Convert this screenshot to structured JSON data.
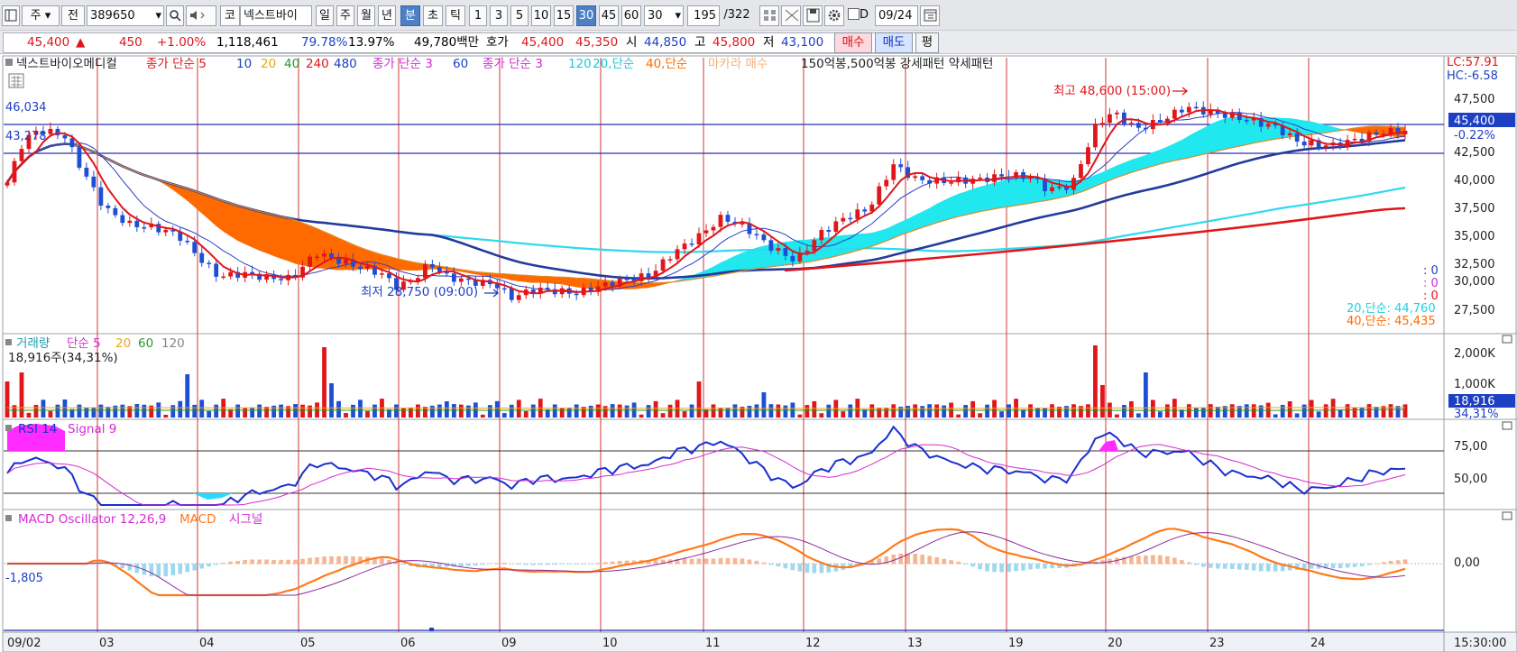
{
  "toolbar": {
    "market": "주",
    "prev_button": "전",
    "stock_code": "389650",
    "code_prefix": "코",
    "stock_name": "넥스트바이",
    "periods": [
      "일",
      "주",
      "월",
      "년",
      "분",
      "초",
      "틱"
    ],
    "selected_period": "분",
    "intervals": [
      "1",
      "3",
      "5",
      "10",
      "15",
      "30",
      "45",
      "60"
    ],
    "selected_interval": "30",
    "interval_input": "30",
    "bar_count": "195",
    "bar_total": "/322",
    "checkbox_label": "D",
    "date": "09/24"
  },
  "quote": {
    "price": "45,400",
    "change_arrow": "▲",
    "change": "450",
    "change_pct": "+1.00%",
    "volume": "1,118,461",
    "ratio1": "79.78%",
    "ratio2": "13.97%",
    "amount": "49,780백만",
    "hoga_label": "호가",
    "ask": "45,400",
    "bid": "45,350",
    "open_label": "시",
    "open": "44,850",
    "high_label": "고",
    "high": "45,800",
    "low_label": "저",
    "low": "43,100",
    "buy_label": "매수",
    "sell_label": "매도",
    "avg_label": "평"
  },
  "price_panel": {
    "legend": {
      "name": "넥스트바이오메디컬",
      "ma1": "종가 단순 5",
      "ma1_p2": "10",
      "ma1_p3": "20",
      "ma1_p4": "40",
      "ma1_p5": "240",
      "ma1_p6": "480",
      "ma2": "종가 단순 3",
      "ma2_p2": "60",
      "ma3": "종가 단순 3",
      "ma3_p2": "120",
      "ma3_p3": "20,단순",
      "ma3_p4": "40,단순",
      "makara": "마카라 매수",
      "patterns": "150억봉,500억봉 강세패턴  약세패턴"
    },
    "lc_label": "LC:57.91",
    "hc_label": "HC:-6.58",
    "hline_labels": [
      "46,034",
      "43,278"
    ],
    "price_ticks": [
      "47,500",
      "45,000",
      "42,500",
      "40,000",
      "37,500",
      "35,000",
      "32,500",
      "30,000",
      "27,500"
    ],
    "current_price_tag": "45,400",
    "current_pct": "-0.22%",
    "max_label": "최고 48,600 (15:00)",
    "min_label": "최저 28,750 (09:00)",
    "mini_values": [
      ": 0",
      ": 0",
      ": 0"
    ],
    "ma20_label": "20,단순: 44,760",
    "ma40_label": "40,단순: 45,435"
  },
  "volume_panel": {
    "legend_label": "거래량",
    "legend_ma": "단순 5",
    "legend_p2": "20",
    "legend_p3": "60",
    "legend_p4": "120",
    "value_label": "18,916주(34,31%)",
    "ticks": [
      "2,000K",
      "1,000K"
    ],
    "current_tag": "18,916",
    "current_pct": "34,31%"
  },
  "rsi_panel": {
    "legend_label": "RSI 14",
    "legend_signal": "Signal 9",
    "ticks": [
      "75,00",
      "50,00"
    ]
  },
  "macd_panel": {
    "legend_label": "MACD Oscillator 12,26,9",
    "legend_macd": "MACD",
    "legend_signal": "시그널",
    "value_label": "-1,805",
    "ticks": [
      "0,00"
    ]
  },
  "x_axis": {
    "labels": [
      "09/02",
      "03",
      "04",
      "05",
      "06",
      "09",
      "10",
      "11",
      "12",
      "13",
      "19",
      "20",
      "23",
      "24"
    ],
    "time": "15:30:00"
  },
  "colors": {
    "up": "#e0161b",
    "down": "#1d4fd6",
    "ma5": "#e0161b",
    "ma20_fill": "#20e8ee",
    "ma40_fill": "#ff6a00",
    "ma60": "#233b9b",
    "ma120": "#2ed8ef",
    "ma240": "#e0161b",
    "rsi": "#1a2fd0",
    "signal": "#d42bd4",
    "macd": "#ff7a1a"
  }
}
